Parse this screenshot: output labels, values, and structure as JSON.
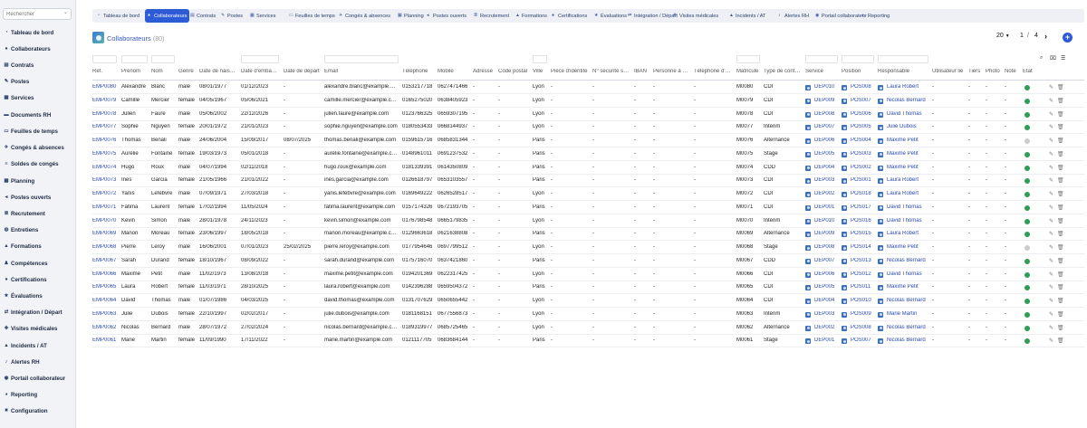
{
  "sidebar": {
    "search_placeholder": "Rechercher",
    "items": [
      {
        "label": "Tableau de bord",
        "icon": "dashboard-icon",
        "glyph": "◔"
      },
      {
        "label": "Collaborateurs",
        "icon": "user-icon",
        "glyph": "●"
      },
      {
        "label": "Contrats",
        "icon": "file-icon",
        "glyph": "▤"
      },
      {
        "label": "Postes",
        "icon": "briefcase-icon",
        "glyph": "✎"
      },
      {
        "label": "Services",
        "icon": "building-icon",
        "glyph": "▦"
      },
      {
        "label": "Documents RH",
        "icon": "folder-icon",
        "glyph": "▬"
      },
      {
        "label": "Feuilles de temps",
        "icon": "clock-icon",
        "glyph": "▭"
      },
      {
        "label": "Congés & absences",
        "icon": "plane-icon",
        "glyph": "✈"
      },
      {
        "label": "Soldes de congés",
        "icon": "balance-icon",
        "glyph": "≡"
      },
      {
        "label": "Planning",
        "icon": "calendar-icon",
        "glyph": "▦"
      },
      {
        "label": "Postes ouverts",
        "icon": "megaphone-icon",
        "glyph": "◂"
      },
      {
        "label": "Recrutement",
        "icon": "recruit-icon",
        "glyph": "≣"
      },
      {
        "label": "Entretiens",
        "icon": "chat-icon",
        "glyph": "◍"
      },
      {
        "label": "Formations",
        "icon": "graduation-icon",
        "glyph": "▲"
      },
      {
        "label": "Compétences",
        "icon": "skills-icon",
        "glyph": "♟"
      },
      {
        "label": "Certifications",
        "icon": "certificate-icon",
        "glyph": "●"
      },
      {
        "label": "Évaluations",
        "icon": "star-icon",
        "glyph": "★"
      },
      {
        "label": "Intégration / Départ",
        "icon": "door-icon",
        "glyph": "⇄"
      },
      {
        "label": "Visites médicales",
        "icon": "stethoscope-icon",
        "glyph": "✚"
      },
      {
        "label": "Incidents / AT",
        "icon": "warning-icon",
        "glyph": "▲"
      },
      {
        "label": "Alertes RH",
        "icon": "bell-icon",
        "glyph": "♪"
      },
      {
        "label": "Portail collaborateur",
        "icon": "portal-icon",
        "glyph": "◉"
      },
      {
        "label": "Reporting",
        "icon": "chart-icon",
        "glyph": "◕"
      },
      {
        "label": "Configuration",
        "icon": "gear-icon",
        "glyph": "✷"
      }
    ]
  },
  "tabs": [
    {
      "label": "Tableau de bord",
      "icon": "dashboard-icon",
      "glyph": "◔"
    },
    {
      "label": "Collaborateurs",
      "icon": "user-icon",
      "glyph": "●",
      "active": true
    },
    {
      "label": "Contrats",
      "icon": "file-icon",
      "glyph": "▤"
    },
    {
      "label": "Postes",
      "icon": "briefcase-icon",
      "glyph": "✎"
    },
    {
      "label": "Services",
      "icon": "building-icon",
      "glyph": "▦"
    },
    {
      "label": "Feuilles de temps",
      "icon": "clock-icon",
      "glyph": "▭"
    },
    {
      "label": "Congés & absences",
      "icon": "plane-icon",
      "glyph": "✈"
    },
    {
      "label": "Planning",
      "icon": "calendar-icon",
      "glyph": "▦"
    },
    {
      "label": "Postes ouverts",
      "icon": "megaphone-icon",
      "glyph": "◂"
    },
    {
      "label": "Recrutement",
      "icon": "recruit-icon",
      "glyph": "≣"
    },
    {
      "label": "Formations",
      "icon": "graduation-icon",
      "glyph": "▲"
    },
    {
      "label": "Certifications",
      "icon": "certificate-icon",
      "glyph": "●"
    },
    {
      "label": "Évaluations",
      "icon": "star-icon",
      "glyph": "★"
    },
    {
      "label": "Intégration / Départ",
      "icon": "door-icon",
      "glyph": "⇄"
    },
    {
      "label": "Visites médicales",
      "icon": "stethoscope-icon",
      "glyph": "✚"
    },
    {
      "label": "Incidents / AT",
      "icon": "warning-icon",
      "glyph": "▲"
    },
    {
      "label": "Alertes RH",
      "icon": "bell-icon",
      "glyph": "♪"
    },
    {
      "label": "Portail collaborateur",
      "icon": "portal-icon",
      "glyph": "◉"
    },
    {
      "label": "Reporting",
      "icon": "chart-icon",
      "glyph": "◕"
    }
  ],
  "page": {
    "title": "Collaborateurs",
    "count": "(80)"
  },
  "pager": {
    "page_size": "20",
    "current": "1",
    "separator": "/",
    "total": "4"
  },
  "colors": {
    "accent": "#2d5bd6",
    "status_active": "#2e9e55",
    "status_inactive": "#cccccc",
    "link": "#2a4ab0"
  },
  "columns": [
    "Réf.",
    "Prénom",
    "Nom",
    "Genre",
    "Date de nais…",
    "Date d'emba…",
    "Date de départ",
    "Email",
    "Téléphone",
    "Mobile",
    "Adresse",
    "Code postal",
    "Ville",
    "Pièce d'identité",
    "N° sécurité s…",
    "IBAN",
    "Personne à …",
    "Téléphone d'…",
    "Matricule",
    "Type de cont…",
    "Service",
    "Position",
    "Responsable",
    "Utilisateur lié",
    "Tiers",
    "Photo",
    "Note",
    "État"
  ],
  "rows": [
    {
      "ref": "EMP0080",
      "prenom": "Alexandre",
      "nom": "Blanc",
      "genre": "male",
      "naissance": "08/01/1977",
      "embauche": "01/12/2023",
      "depart": "-",
      "email": "alexandre.blanc@example.…",
      "tel": "0153217718",
      "mobile": "0627471466",
      "ville": "Lyon",
      "matricule": "M0080",
      "contrat": "CDI",
      "service": "DEP010",
      "position": "POS008",
      "responsable": "Laura Robert",
      "active": true
    },
    {
      "ref": "EMP0079",
      "prenom": "Camille",
      "nom": "Mercier",
      "genre": "female",
      "naissance": "04/05/1967",
      "embauche": "05/06/2021",
      "depart": "-",
      "email": "camille.mercier@example.c…",
      "tel": "0165275020",
      "mobile": "0638405923",
      "ville": "Lyon",
      "matricule": "M0079",
      "contrat": "CDI",
      "service": "DEP009",
      "position": "POS007",
      "responsable": "Nicolas Bernard",
      "active": true
    },
    {
      "ref": "EMP0078",
      "prenom": "Julien",
      "nom": "Faure",
      "genre": "male",
      "naissance": "05/06/2002",
      "embauche": "22/12/2026",
      "depart": "-",
      "email": "julien.faure@example.com",
      "tel": "0123766325",
      "mobile": "0659307195",
      "ville": "Lyon",
      "matricule": "M0078",
      "contrat": "CDI",
      "service": "DEP008",
      "position": "POS006",
      "responsable": "David Thomas",
      "active": true
    },
    {
      "ref": "EMP0077",
      "prenom": "Sophie",
      "nom": "Nguyen",
      "genre": "female",
      "naissance": "20/01/1972",
      "embauche": "21/01/2023",
      "depart": "-",
      "email": "sophie.nguyen@example.com",
      "tel": "0180553433",
      "mobile": "0668144937",
      "ville": "Lyon",
      "matricule": "M0077",
      "contrat": "Intérim",
      "service": "DEP007",
      "position": "POS005",
      "responsable": "Julie Dubois",
      "active": true
    },
    {
      "ref": "EMP0076",
      "prenom": "Thomas",
      "nom": "Benali",
      "genre": "male",
      "naissance": "24/06/2004",
      "embauche": "15/09/2017",
      "depart": "08/07/2025",
      "email": "thomas.benali@example.com",
      "tel": "0159615716",
      "mobile": "0685831344",
      "ville": "Paris",
      "matricule": "M0076",
      "contrat": "Alternance",
      "service": "DEP006",
      "position": "POS004",
      "responsable": "Maxime Petit",
      "active": false
    },
    {
      "ref": "EMP0075",
      "prenom": "Aurélie",
      "nom": "Fontaine",
      "genre": "female",
      "naissance": "19/03/1973",
      "embauche": "05/01/2018",
      "depart": "-",
      "email": "aurélie.fontaine@example.c…",
      "tel": "0148961011",
      "mobile": "0691237532",
      "ville": "Paris",
      "matricule": "M0075",
      "contrat": "Stage",
      "service": "DEP005",
      "position": "POS003",
      "responsable": "Maxime Petit",
      "active": true
    },
    {
      "ref": "EMP0074",
      "prenom": "Hugo",
      "nom": "Roux",
      "genre": "male",
      "naissance": "04/07/1994",
      "embauche": "02/11/2018",
      "depart": "-",
      "email": "hugo.roux@example.com",
      "tel": "0181339391",
      "mobile": "0614350809",
      "ville": "Paris",
      "matricule": "M0074",
      "contrat": "CDD",
      "service": "DEP004",
      "position": "POS002",
      "responsable": "Maxime Petit",
      "active": true
    },
    {
      "ref": "EMP0073",
      "prenom": "Inès",
      "nom": "Garcia",
      "genre": "female",
      "naissance": "21/05/1966",
      "embauche": "21/01/2022",
      "depart": "-",
      "email": "inès.garcia@example.com",
      "tel": "0126618797",
      "mobile": "0653103557",
      "ville": "Paris",
      "matricule": "M0073",
      "contrat": "CDI",
      "service": "DEP003",
      "position": "POS001",
      "responsable": "Laura Robert",
      "active": true
    },
    {
      "ref": "EMP0072",
      "prenom": "Yanis",
      "nom": "Lefebvre",
      "genre": "male",
      "naissance": "07/09/1971",
      "embauche": "27/03/2018",
      "depart": "-",
      "email": "yanis.lefebvre@example.com",
      "tel": "0169649222",
      "mobile": "0626528517",
      "ville": "Lyon",
      "matricule": "M0072",
      "contrat": "CDI",
      "service": "DEP002",
      "position": "POS018",
      "responsable": "Laura Robert",
      "active": true
    },
    {
      "ref": "EMP0071",
      "prenom": "Fatima",
      "nom": "Laurent",
      "genre": "female",
      "naissance": "17/02/1994",
      "embauche": "11/05/2024",
      "depart": "-",
      "email": "fatima.laurent@example.com",
      "tel": "0157174326",
      "mobile": "0672193705",
      "ville": "Paris",
      "matricule": "M0071",
      "contrat": "CDI",
      "service": "DEP001",
      "position": "POS017",
      "responsable": "David Thomas",
      "active": true
    },
    {
      "ref": "EMP0070",
      "prenom": "Kevin",
      "nom": "Simon",
      "genre": "male",
      "naissance": "28/01/1978",
      "embauche": "24/11/2023",
      "depart": "-",
      "email": "kevin.simon@example.com",
      "tel": "0176798548",
      "mobile": "0665179835",
      "ville": "Lyon",
      "matricule": "M0070",
      "contrat": "Intérim",
      "service": "DEP010",
      "position": "POS016",
      "responsable": "David Thomas",
      "active": true
    },
    {
      "ref": "EMP0069",
      "prenom": "Manon",
      "nom": "Moreau",
      "genre": "female",
      "naissance": "23/06/1997",
      "embauche": "18/05/2018",
      "depart": "-",
      "email": "manon.moreau@example.c…",
      "tel": "0129663618",
      "mobile": "0621638808",
      "ville": "Paris",
      "matricule": "M0069",
      "contrat": "Alternance",
      "service": "DEP009",
      "position": "POS015",
      "responsable": "Laura Robert",
      "active": true
    },
    {
      "ref": "EMP0068",
      "prenom": "Pierre",
      "nom": "Leroy",
      "genre": "male",
      "naissance": "16/06/2001",
      "embauche": "07/01/2023",
      "depart": "25/02/2025",
      "email": "pierre.leroy@example.com",
      "tel": "0177954646",
      "mobile": "0697799512",
      "ville": "Lyon",
      "matricule": "M0068",
      "contrat": "Stage",
      "service": "DEP008",
      "position": "POS014",
      "responsable": "Maxime Petit",
      "active": false
    },
    {
      "ref": "EMP0067",
      "prenom": "Sarah",
      "nom": "Durand",
      "genre": "female",
      "naissance": "18/10/1967",
      "embauche": "08/09/2022",
      "depart": "-",
      "email": "sarah.durand@example.com",
      "tel": "0175716070",
      "mobile": "0637421860",
      "ville": "Paris",
      "matricule": "M0067",
      "contrat": "CDD",
      "service": "DEP007",
      "position": "POS013",
      "responsable": "Nicolas Bernard",
      "active": true
    },
    {
      "ref": "EMP0066",
      "prenom": "Maxime",
      "nom": "Petit",
      "genre": "male",
      "naissance": "11/02/1973",
      "embauche": "13/08/2018",
      "depart": "-",
      "email": "maxime.petit@example.com",
      "tel": "0194201369",
      "mobile": "0622317425",
      "ville": "Lyon",
      "matricule": "M0066",
      "contrat": "CDI",
      "service": "DEP006",
      "position": "POS012",
      "responsable": "David Thomas",
      "active": true
    },
    {
      "ref": "EMP0065",
      "prenom": "Laura",
      "nom": "Robert",
      "genre": "female",
      "naissance": "11/03/1971",
      "embauche": "28/10/2025",
      "depart": "-",
      "email": "laura.robert@example.com",
      "tel": "0142396288",
      "mobile": "0659504372",
      "ville": "Paris",
      "matricule": "M0065",
      "contrat": "CDI",
      "service": "DEP005",
      "position": "POS011",
      "responsable": "Maxime Petit",
      "active": true
    },
    {
      "ref": "EMP0064",
      "prenom": "David",
      "nom": "Thomas",
      "genre": "male",
      "naissance": "01/07/1986",
      "embauche": "04/03/2025",
      "depart": "-",
      "email": "david.thomas@example.com",
      "tel": "0131707629",
      "mobile": "0650655442",
      "ville": "Lyon",
      "matricule": "M0064",
      "contrat": "CDI",
      "service": "DEP004",
      "position": "POS010",
      "responsable": "Nicolas Bernard",
      "active": true
    },
    {
      "ref": "EMP0063",
      "prenom": "Julie",
      "nom": "Dubois",
      "genre": "female",
      "naissance": "22/10/1997",
      "embauche": "02/02/2017",
      "depart": "-",
      "email": "julie.dubois@example.com",
      "tel": "0181168151",
      "mobile": "0677556873",
      "ville": "Lyon",
      "matricule": "M0063",
      "contrat": "Intérim",
      "service": "DEP003",
      "position": "POS009",
      "responsable": "Marie Martin",
      "active": true
    },
    {
      "ref": "EMP0062",
      "prenom": "Nicolas",
      "nom": "Bernard",
      "genre": "male",
      "naissance": "28/07/1972",
      "embauche": "27/02/2024",
      "depart": "-",
      "email": "nicolas.bernard@example.c…",
      "tel": "0189319977",
      "mobile": "0685725465",
      "ville": "Lyon",
      "matricule": "M0062",
      "contrat": "Alternance",
      "service": "DEP002",
      "position": "POS008",
      "responsable": "Nicolas Bernard",
      "active": true
    },
    {
      "ref": "EMP0061",
      "prenom": "Marie",
      "nom": "Martin",
      "genre": "female",
      "naissance": "11/09/1990",
      "embauche": "17/11/2022",
      "depart": "-",
      "email": "marie.martin@example.com",
      "tel": "0121117705",
      "mobile": "0683684144",
      "ville": "Paris",
      "matricule": "M0061",
      "contrat": "Stage",
      "service": "DEP001",
      "position": "POS007",
      "responsable": "Nicolas Bernard",
      "active": true
    }
  ]
}
